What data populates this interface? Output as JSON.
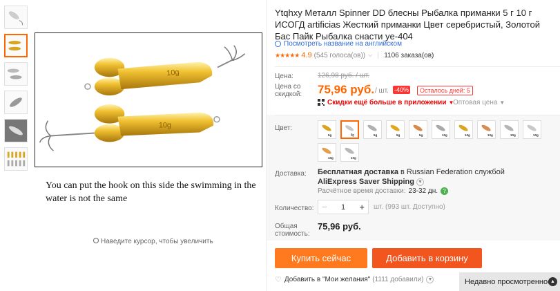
{
  "gallery": {
    "caption": "You can put the hook on this side the swimming in the water is not the same",
    "zoom_hint": "Наведите курсор, чтобы увеличить",
    "main_lure_label": "10g",
    "thumbnails": [
      "thumb-1",
      "thumb-2",
      "thumb-3",
      "thumb-4",
      "thumb-5",
      "thumb-6"
    ]
  },
  "product": {
    "title": "Ytqhxy Металл Spinner DD блесны Рыбалка приманки 5 г 10 г ИСОГД artificias Жесткий приманки Цвет серебристый, Золотой Бас Пайк Рыбалка снасти ye-404",
    "translate_link": "Посмотреть название на английском",
    "stars": "★★★★★",
    "rating": "4.9",
    "votes": "(545 голоса(ов))",
    "orders": "1106 заказа(ов)"
  },
  "pricing": {
    "price_label": "Цена:",
    "old_price": "126,98 руб. / шт.",
    "discount_label": "Цена со скидкой:",
    "price": "75,96 руб.",
    "per_unit": "/ шт.",
    "discount": "-40%",
    "days_left": "Осталось дней: 5",
    "app_promo": "Скидки ещё больше в приложении",
    "wholesale": "Оптовая цена"
  },
  "options": {
    "color_label": "Цвет:",
    "swatches": [
      {
        "label": "5g",
        "color": "#d9a520"
      },
      {
        "label": "5g",
        "color": "#c8c8c8"
      },
      {
        "label": "5g",
        "color": "#b0b0b0"
      },
      {
        "label": "5g",
        "color": "#e3a71f"
      },
      {
        "label": "5g",
        "color": "#d98a4a"
      },
      {
        "label": "10g",
        "color": "#a9a9a9"
      },
      {
        "label": "10g",
        "color": "#d9a520"
      },
      {
        "label": "10g",
        "color": "#d68c55"
      },
      {
        "label": "10g",
        "color": "#b5b5b5"
      },
      {
        "label": "10g",
        "color": "#c9c9c9"
      },
      {
        "label": "10g",
        "color": "#e0a050"
      },
      {
        "label": "10g",
        "color": "#b8b8b8"
      }
    ],
    "selected_index": 1
  },
  "shipping": {
    "label": "Доставка:",
    "line1_prefix": "Бесплатная доставка",
    "line1_middle": " в Russian Federation службой",
    "service": "AliExpress Saver Shipping",
    "time_label": "Расчётное время доставки:",
    "time_value": "23-32 дн."
  },
  "quantity": {
    "label": "Количество:",
    "value": "1",
    "stock": "шт. (993 шт. Доступно)"
  },
  "total": {
    "label": "Общая стоимость:",
    "value": "75,96 руб."
  },
  "actions": {
    "buy_now": "Купить сейчас",
    "add_to_cart": "Добавить в корзину",
    "wishlist": "Добавить в \"Мои желания\"",
    "wishlist_count": "(1111 добавили)"
  },
  "recently_viewed": "Недавно просмотренное",
  "colors": {
    "accent": "#ff7a1f",
    "cart": "#f2551e",
    "price": "#ff6600",
    "link": "#2e6bd6"
  }
}
